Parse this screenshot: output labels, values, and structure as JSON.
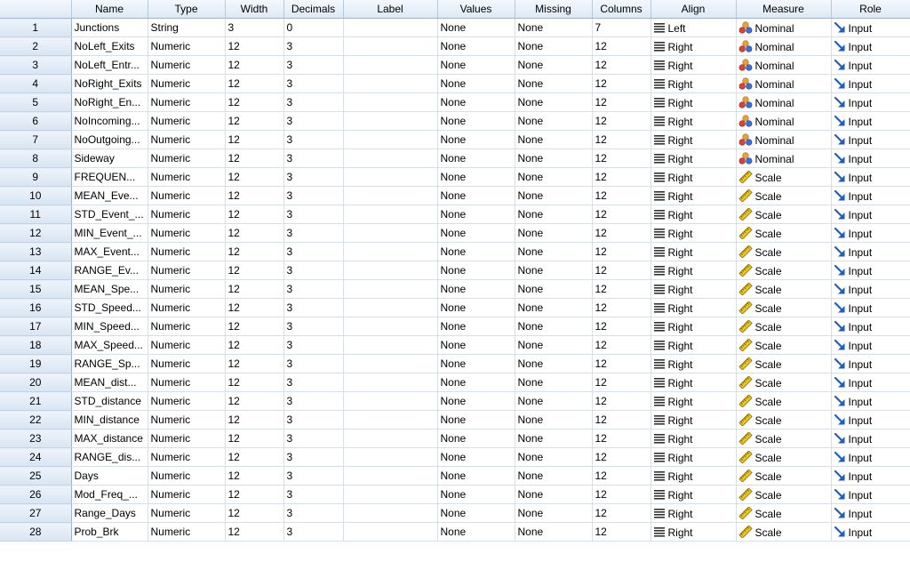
{
  "columns": [
    "Name",
    "Type",
    "Width",
    "Decimals",
    "Label",
    "Values",
    "Missing",
    "Columns",
    "Align",
    "Measure",
    "Role"
  ],
  "icons": {
    "align": "align-lines-icon",
    "nominal": "nominal-balls-icon",
    "scale": "scale-ruler-icon",
    "role": "input-arrow-icon"
  },
  "colors": {
    "header_bg": "#dde8f5",
    "grid_line": "#d7dee8",
    "role_arrow": "#1f5fbf"
  },
  "rows": [
    {
      "num": "1",
      "name": "Junctions",
      "type": "String",
      "width": "3",
      "decimals": "0",
      "label": "",
      "values": "None",
      "missing": "None",
      "columns": "7",
      "align": "Left",
      "measure": "Nominal",
      "role": "Input"
    },
    {
      "num": "2",
      "name": "NoLeft_Exits",
      "type": "Numeric",
      "width": "12",
      "decimals": "3",
      "label": "",
      "values": "None",
      "missing": "None",
      "columns": "12",
      "align": "Right",
      "measure": "Nominal",
      "role": "Input"
    },
    {
      "num": "3",
      "name": "NoLeft_Entr...",
      "type": "Numeric",
      "width": "12",
      "decimals": "3",
      "label": "",
      "values": "None",
      "missing": "None",
      "columns": "12",
      "align": "Right",
      "measure": "Nominal",
      "role": "Input"
    },
    {
      "num": "4",
      "name": "NoRight_Exits",
      "type": "Numeric",
      "width": "12",
      "decimals": "3",
      "label": "",
      "values": "None",
      "missing": "None",
      "columns": "12",
      "align": "Right",
      "measure": "Nominal",
      "role": "Input"
    },
    {
      "num": "5",
      "name": "NoRight_En...",
      "type": "Numeric",
      "width": "12",
      "decimals": "3",
      "label": "",
      "values": "None",
      "missing": "None",
      "columns": "12",
      "align": "Right",
      "measure": "Nominal",
      "role": "Input"
    },
    {
      "num": "6",
      "name": "NoIncoming...",
      "type": "Numeric",
      "width": "12",
      "decimals": "3",
      "label": "",
      "values": "None",
      "missing": "None",
      "columns": "12",
      "align": "Right",
      "measure": "Nominal",
      "role": "Input"
    },
    {
      "num": "7",
      "name": "NoOutgoing...",
      "type": "Numeric",
      "width": "12",
      "decimals": "3",
      "label": "",
      "values": "None",
      "missing": "None",
      "columns": "12",
      "align": "Right",
      "measure": "Nominal",
      "role": "Input"
    },
    {
      "num": "8",
      "name": "Sideway",
      "type": "Numeric",
      "width": "12",
      "decimals": "3",
      "label": "",
      "values": "None",
      "missing": "None",
      "columns": "12",
      "align": "Right",
      "measure": "Nominal",
      "role": "Input"
    },
    {
      "num": "9",
      "name": "FREQUEN...",
      "type": "Numeric",
      "width": "12",
      "decimals": "3",
      "label": "",
      "values": "None",
      "missing": "None",
      "columns": "12",
      "align": "Right",
      "measure": "Scale",
      "role": "Input"
    },
    {
      "num": "10",
      "name": "MEAN_Eve...",
      "type": "Numeric",
      "width": "12",
      "decimals": "3",
      "label": "",
      "values": "None",
      "missing": "None",
      "columns": "12",
      "align": "Right",
      "measure": "Scale",
      "role": "Input"
    },
    {
      "num": "11",
      "name": "STD_Event_...",
      "type": "Numeric",
      "width": "12",
      "decimals": "3",
      "label": "",
      "values": "None",
      "missing": "None",
      "columns": "12",
      "align": "Right",
      "measure": "Scale",
      "role": "Input"
    },
    {
      "num": "12",
      "name": "MIN_Event_...",
      "type": "Numeric",
      "width": "12",
      "decimals": "3",
      "label": "",
      "values": "None",
      "missing": "None",
      "columns": "12",
      "align": "Right",
      "measure": "Scale",
      "role": "Input"
    },
    {
      "num": "13",
      "name": "MAX_Event...",
      "type": "Numeric",
      "width": "12",
      "decimals": "3",
      "label": "",
      "values": "None",
      "missing": "None",
      "columns": "12",
      "align": "Right",
      "measure": "Scale",
      "role": "Input"
    },
    {
      "num": "14",
      "name": "RANGE_Ev...",
      "type": "Numeric",
      "width": "12",
      "decimals": "3",
      "label": "",
      "values": "None",
      "missing": "None",
      "columns": "12",
      "align": "Right",
      "measure": "Scale",
      "role": "Input"
    },
    {
      "num": "15",
      "name": "MEAN_Spe...",
      "type": "Numeric",
      "width": "12",
      "decimals": "3",
      "label": "",
      "values": "None",
      "missing": "None",
      "columns": "12",
      "align": "Right",
      "measure": "Scale",
      "role": "Input"
    },
    {
      "num": "16",
      "name": "STD_Speed...",
      "type": "Numeric",
      "width": "12",
      "decimals": "3",
      "label": "",
      "values": "None",
      "missing": "None",
      "columns": "12",
      "align": "Right",
      "measure": "Scale",
      "role": "Input"
    },
    {
      "num": "17",
      "name": "MIN_Speed...",
      "type": "Numeric",
      "width": "12",
      "decimals": "3",
      "label": "",
      "values": "None",
      "missing": "None",
      "columns": "12",
      "align": "Right",
      "measure": "Scale",
      "role": "Input"
    },
    {
      "num": "18",
      "name": "MAX_Speed...",
      "type": "Numeric",
      "width": "12",
      "decimals": "3",
      "label": "",
      "values": "None",
      "missing": "None",
      "columns": "12",
      "align": "Right",
      "measure": "Scale",
      "role": "Input"
    },
    {
      "num": "19",
      "name": "RANGE_Sp...",
      "type": "Numeric",
      "width": "12",
      "decimals": "3",
      "label": "",
      "values": "None",
      "missing": "None",
      "columns": "12",
      "align": "Right",
      "measure": "Scale",
      "role": "Input"
    },
    {
      "num": "20",
      "name": "MEAN_dist...",
      "type": "Numeric",
      "width": "12",
      "decimals": "3",
      "label": "",
      "values": "None",
      "missing": "None",
      "columns": "12",
      "align": "Right",
      "measure": "Scale",
      "role": "Input"
    },
    {
      "num": "21",
      "name": "STD_distance",
      "type": "Numeric",
      "width": "12",
      "decimals": "3",
      "label": "",
      "values": "None",
      "missing": "None",
      "columns": "12",
      "align": "Right",
      "measure": "Scale",
      "role": "Input"
    },
    {
      "num": "22",
      "name": "MIN_distance",
      "type": "Numeric",
      "width": "12",
      "decimals": "3",
      "label": "",
      "values": "None",
      "missing": "None",
      "columns": "12",
      "align": "Right",
      "measure": "Scale",
      "role": "Input"
    },
    {
      "num": "23",
      "name": "MAX_distance",
      "type": "Numeric",
      "width": "12",
      "decimals": "3",
      "label": "",
      "values": "None",
      "missing": "None",
      "columns": "12",
      "align": "Right",
      "measure": "Scale",
      "role": "Input"
    },
    {
      "num": "24",
      "name": "RANGE_dis...",
      "type": "Numeric",
      "width": "12",
      "decimals": "3",
      "label": "",
      "values": "None",
      "missing": "None",
      "columns": "12",
      "align": "Right",
      "measure": "Scale",
      "role": "Input"
    },
    {
      "num": "25",
      "name": "Days",
      "type": "Numeric",
      "width": "12",
      "decimals": "3",
      "label": "",
      "values": "None",
      "missing": "None",
      "columns": "12",
      "align": "Right",
      "measure": "Scale",
      "role": "Input"
    },
    {
      "num": "26",
      "name": "Mod_Freq_...",
      "type": "Numeric",
      "width": "12",
      "decimals": "3",
      "label": "",
      "values": "None",
      "missing": "None",
      "columns": "12",
      "align": "Right",
      "measure": "Scale",
      "role": "Input"
    },
    {
      "num": "27",
      "name": "Range_Days",
      "type": "Numeric",
      "width": "12",
      "decimals": "3",
      "label": "",
      "values": "None",
      "missing": "None",
      "columns": "12",
      "align": "Right",
      "measure": "Scale",
      "role": "Input"
    },
    {
      "num": "28",
      "name": "Prob_Brk",
      "type": "Numeric",
      "width": "12",
      "decimals": "3",
      "label": "",
      "values": "None",
      "missing": "None",
      "columns": "12",
      "align": "Right",
      "measure": "Scale",
      "role": "Input"
    }
  ]
}
